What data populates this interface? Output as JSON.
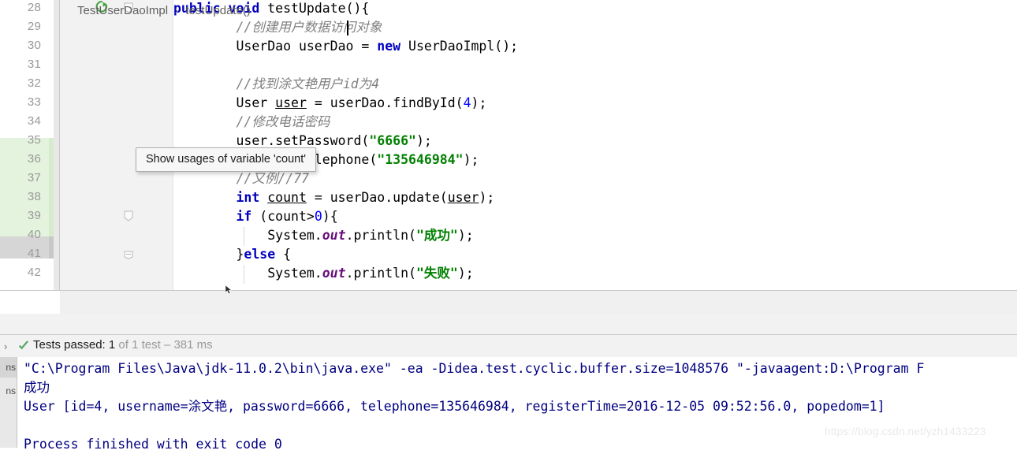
{
  "editor": {
    "first_line_number": 28,
    "caret_line": 29,
    "lines": [
      {
        "num": "28",
        "indent": 0,
        "run_marker": true,
        "fold": "collapse",
        "tokens": [
          {
            "t": "kw",
            "s": "public"
          },
          {
            "t": "plain",
            "s": " "
          },
          {
            "t": "kw",
            "s": "void"
          },
          {
            "t": "plain",
            "s": " testUpdate(){"
          }
        ]
      },
      {
        "num": "29",
        "indent": 0,
        "run_marker": false,
        "fold": "",
        "tokens": [
          {
            "t": "cmt",
            "s": "        //创建用户数据访问对象"
          }
        ]
      },
      {
        "num": "30",
        "indent": 0,
        "run_marker": false,
        "fold": "",
        "tokens": [
          {
            "t": "plain",
            "s": "        UserDao userDao = "
          },
          {
            "t": "kw",
            "s": "new"
          },
          {
            "t": "plain",
            "s": " UserDaoImpl();"
          }
        ]
      },
      {
        "num": "31",
        "indent": 0,
        "run_marker": false,
        "fold": "",
        "tokens": [
          {
            "t": "plain",
            "s": ""
          }
        ]
      },
      {
        "num": "32",
        "indent": 0,
        "run_marker": false,
        "fold": "",
        "tokens": [
          {
            "t": "cmt",
            "s": "        //找到涂文艳用户id为4"
          }
        ]
      },
      {
        "num": "33",
        "indent": 0,
        "run_marker": false,
        "fold": "",
        "tokens": [
          {
            "t": "plain",
            "s": "        User "
          },
          {
            "t": "under",
            "s": "user"
          },
          {
            "t": "plain",
            "s": " = userDao.findById("
          },
          {
            "t": "num",
            "s": "4"
          },
          {
            "t": "plain",
            "s": ");"
          }
        ]
      },
      {
        "num": "34",
        "indent": 0,
        "run_marker": false,
        "fold": "",
        "tokens": [
          {
            "t": "cmt",
            "s": "        //修改电话密码"
          }
        ]
      },
      {
        "num": "35",
        "indent": 0,
        "run_marker": false,
        "fold": "",
        "tokens": [
          {
            "t": "plain",
            "s": "        user.setPassword("
          },
          {
            "t": "str",
            "s": "\"6666\""
          },
          {
            "t": "plain",
            "s": ");"
          }
        ]
      },
      {
        "num": "36",
        "indent": 0,
        "run_marker": false,
        "fold": "",
        "tokens": [
          {
            "t": "plain",
            "s": "        user.setTelephone("
          },
          {
            "t": "str",
            "s": "\"135646984\""
          },
          {
            "t": "plain",
            "s": ");"
          }
        ]
      },
      {
        "num": "37",
        "indent": 0,
        "run_marker": false,
        "fold": "",
        "tokens": [
          {
            "t": "cmt",
            "s": "        //又例//77"
          }
        ]
      },
      {
        "num": "38",
        "indent": 0,
        "run_marker": false,
        "fold": "",
        "tokens": [
          {
            "t": "kw",
            "s": "        int"
          },
          {
            "t": "plain",
            "s": " "
          },
          {
            "t": "under",
            "s": "count"
          },
          {
            "t": "plain",
            "s": " = userDao.update("
          },
          {
            "t": "under",
            "s": "user"
          },
          {
            "t": "plain",
            "s": ");"
          }
        ]
      },
      {
        "num": "39",
        "indent": 0,
        "run_marker": false,
        "fold": "collapse",
        "tokens": [
          {
            "t": "kw",
            "s": "        if"
          },
          {
            "t": "plain",
            "s": " (count>"
          },
          {
            "t": "num",
            "s": "0"
          },
          {
            "t": "plain",
            "s": "){"
          }
        ]
      },
      {
        "num": "40",
        "indent": 1,
        "run_marker": false,
        "fold": "",
        "tokens": [
          {
            "t": "plain",
            "s": "            System."
          },
          {
            "t": "fld",
            "s": "out"
          },
          {
            "t": "plain",
            "s": ".println("
          },
          {
            "t": "str",
            "s": "\"成功\""
          },
          {
            "t": "plain",
            "s": ");"
          }
        ]
      },
      {
        "num": "41",
        "indent": 0,
        "run_marker": false,
        "fold": "end",
        "tokens": [
          {
            "t": "plain",
            "s": "        }"
          },
          {
            "t": "kw",
            "s": "else"
          },
          {
            "t": "plain",
            "s": " {"
          }
        ]
      },
      {
        "num": "42",
        "indent": 1,
        "run_marker": false,
        "fold": "",
        "tokens": [
          {
            "t": "plain",
            "s": "            System."
          },
          {
            "t": "fld",
            "s": "out"
          },
          {
            "t": "plain",
            "s": ".println("
          },
          {
            "t": "str",
            "s": "\"失败\""
          },
          {
            "t": "plain",
            "s": ");"
          }
        ]
      }
    ]
  },
  "tooltip": {
    "text": "Show usages of variable 'count'"
  },
  "breadcrumb": {
    "class_name": "TestUserDaoImpl",
    "separator": "›",
    "method_name": "testUpdate()"
  },
  "test_status": {
    "expander": "›",
    "check_icon": "check-icon",
    "label": "Tests passed: ",
    "count": "1",
    "of_text": " of 1 test ",
    "dash_time": "– 381 ms"
  },
  "tool_tabs": [
    {
      "label": "ns",
      "active": true
    },
    {
      "label": "ns",
      "active": false
    }
  ],
  "console": {
    "lines": [
      "\"C:\\Program Files\\Java\\jdk-11.0.2\\bin\\java.exe\" -ea -Didea.test.cyclic.buffer.size=1048576 \"-javaagent:D:\\Program F",
      "成功",
      "User [id=4, username=涂文艳, password=6666, telephone=135646984, registerTime=2016-12-05 09:52:56.0, popedom=1]",
      "",
      "Process finished with exit code 0"
    ]
  },
  "watermark": {
    "text": "https://blog.csdn.net/yzh1433223"
  },
  "colors": {
    "caret_line_bg": "#fdf8e3",
    "gutter_bg": "#f2f2f2",
    "keyword": "#0000c0",
    "comment": "#808080",
    "string": "#008000",
    "number": "#0000ff",
    "field": "#660e7a",
    "console_text": "#000080",
    "test_pass_green": "#59a869",
    "run_icon_green": "#42a53f"
  }
}
